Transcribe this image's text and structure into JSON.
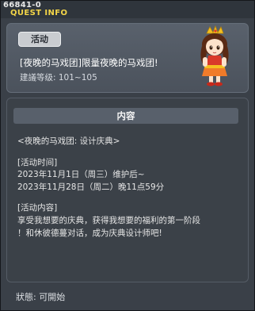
{
  "window": {
    "id_label": "66841-0",
    "title": "QUEST INFO"
  },
  "quest": {
    "badge": "活动",
    "title": "[夜晚的马戏团]限量夜晚的马戏团!",
    "level": "建議等级: 101~105"
  },
  "content": {
    "header": "内容",
    "lines": [
      "<夜晚的马戏团: 设计庆典>",
      "",
      "[活动时间]",
      "2023年11月1日（周三）维护后~",
      "2023年11月28日（周二）晚11点59分",
      "",
      "[活动内容]",
      "享受我想要的庆典，获得我想要的福利的第一阶段",
      "！和休彼德蔓对话，成为庆典设计师吧!"
    ]
  },
  "status": "狀態: 可開始",
  "colors": {
    "title_accent": "#f3d548",
    "panel_bg": "#3b4148",
    "header_bg": "#58606b"
  }
}
